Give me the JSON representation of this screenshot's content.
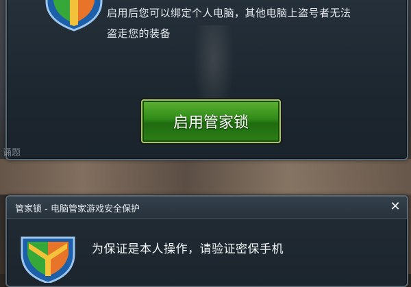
{
  "top_dialog": {
    "description_line1": "启用后您可以绑定个人电脑，其他电脑上盗号者无法",
    "description_line2": "盗走您的装备",
    "enable_button_label": "启用管家锁"
  },
  "background": {
    "left_label": "诵题"
  },
  "bottom_dialog": {
    "title": "管家锁 - 电脑管家游戏安全保护",
    "close_symbol": "✕",
    "message": "为保证是本人操作，请验证密保手机"
  },
  "icons": [
    "shield-icon",
    "close-icon"
  ],
  "colors": {
    "button_green": "#2f8a18",
    "dialog_bg": "#1d2730",
    "border": "#5c6a76"
  }
}
